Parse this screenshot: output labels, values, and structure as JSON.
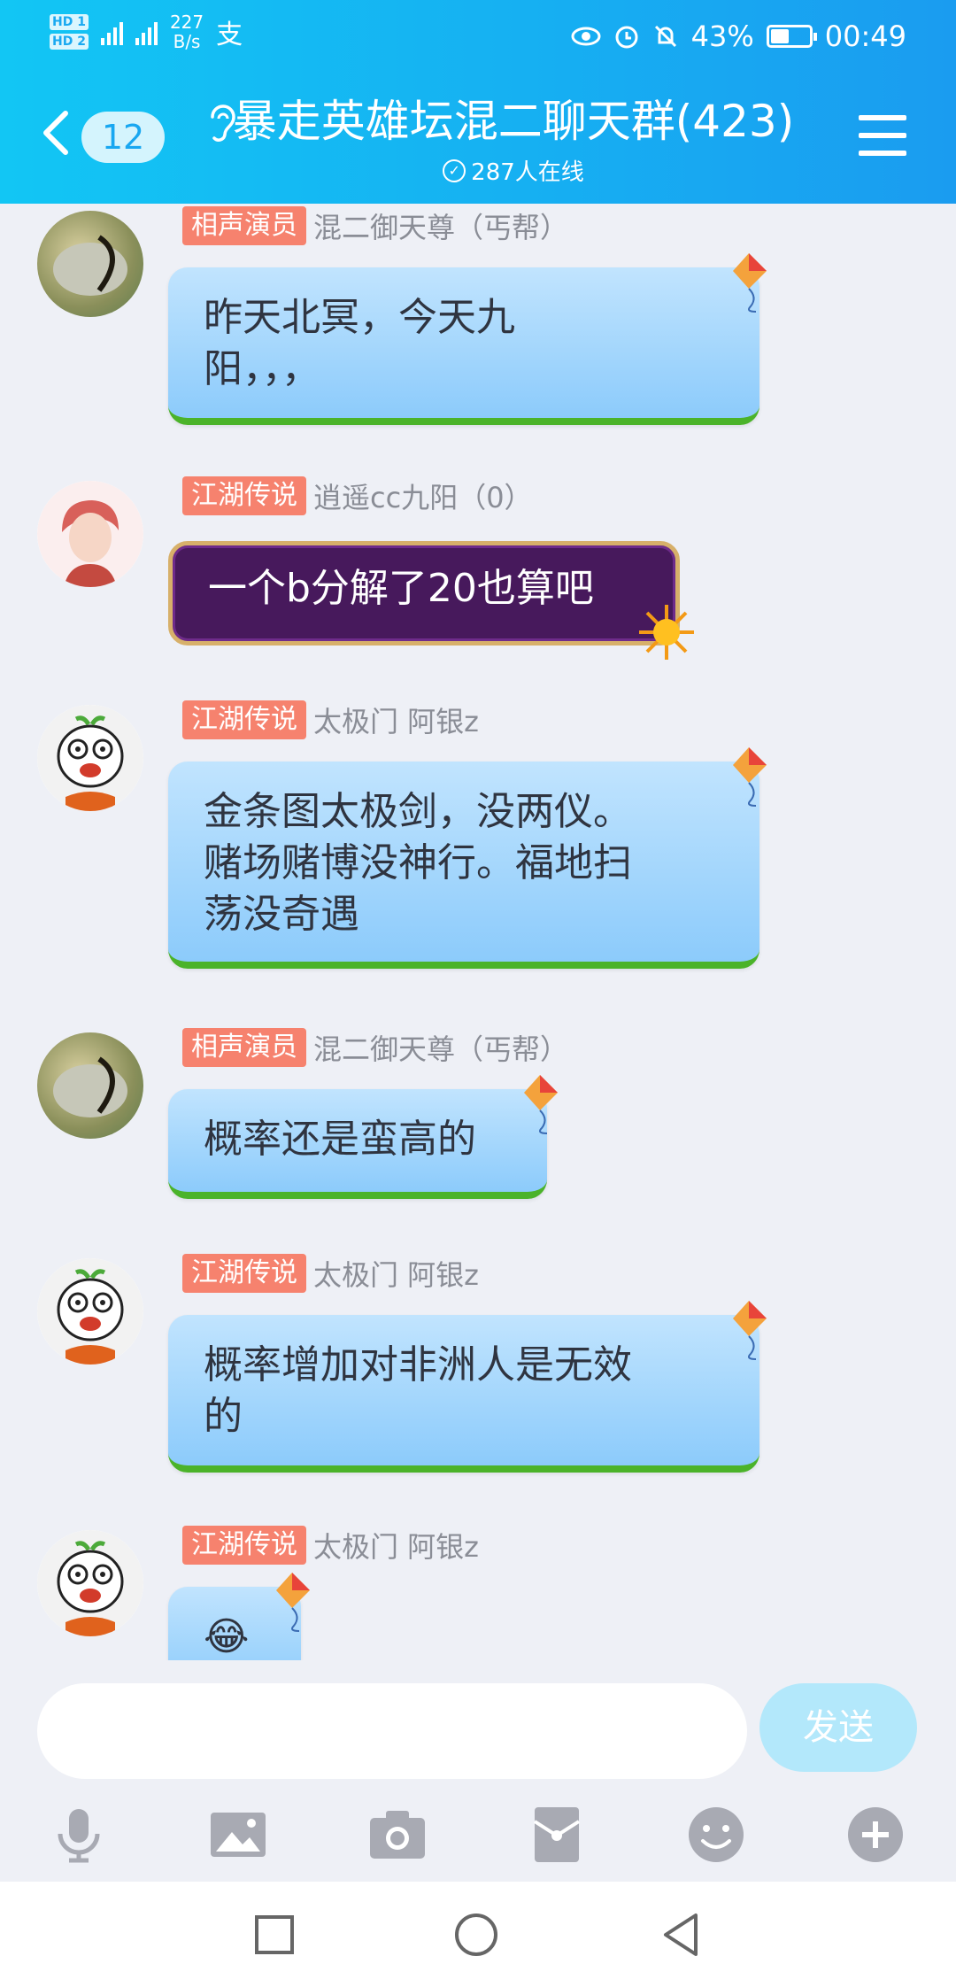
{
  "status": {
    "speed_value": "227",
    "speed_unit": "B/s",
    "pay": "支",
    "battery": "43%",
    "time": "00:49"
  },
  "header": {
    "unread": "12",
    "title": "暴走英雄坛混二聊天群(423)",
    "online": "287人在线"
  },
  "messages": [
    {
      "tag": "相声演员",
      "sender": "混二御天尊（丐帮）",
      "text": "昨天北冥，今天九\n阳，，，"
    },
    {
      "tag": "江湖传说",
      "sender": "逍遥cc九阳（0）",
      "text": "一个b分解了20也算吧"
    },
    {
      "tag": "江湖传说",
      "sender": "太极门 阿银z",
      "text": "金条图太极剑，没两仪。\n赌场赌博没神行。福地扫\n荡没奇遇"
    },
    {
      "tag": "相声演员",
      "sender": "混二御天尊（丐帮）",
      "text": "概率还是蛮高的"
    },
    {
      "tag": "江湖传说",
      "sender": "太极门 阿银z",
      "text": "概率增加对非洲人是无效\n的"
    },
    {
      "tag": "江湖传说",
      "sender": "太极门 阿银z",
      "text": "😂"
    }
  ],
  "composer": {
    "placeholder": "",
    "send_label": "发送"
  },
  "toolbar": [
    "microphone-icon",
    "image-icon",
    "camera-icon",
    "red-packet-icon",
    "emoji-icon",
    "plus-icon"
  ],
  "colors": {
    "header": "#16b0f2",
    "tag": "#f6826e",
    "bubble": "#8ccbfb",
    "send": "#b3e8fb"
  }
}
